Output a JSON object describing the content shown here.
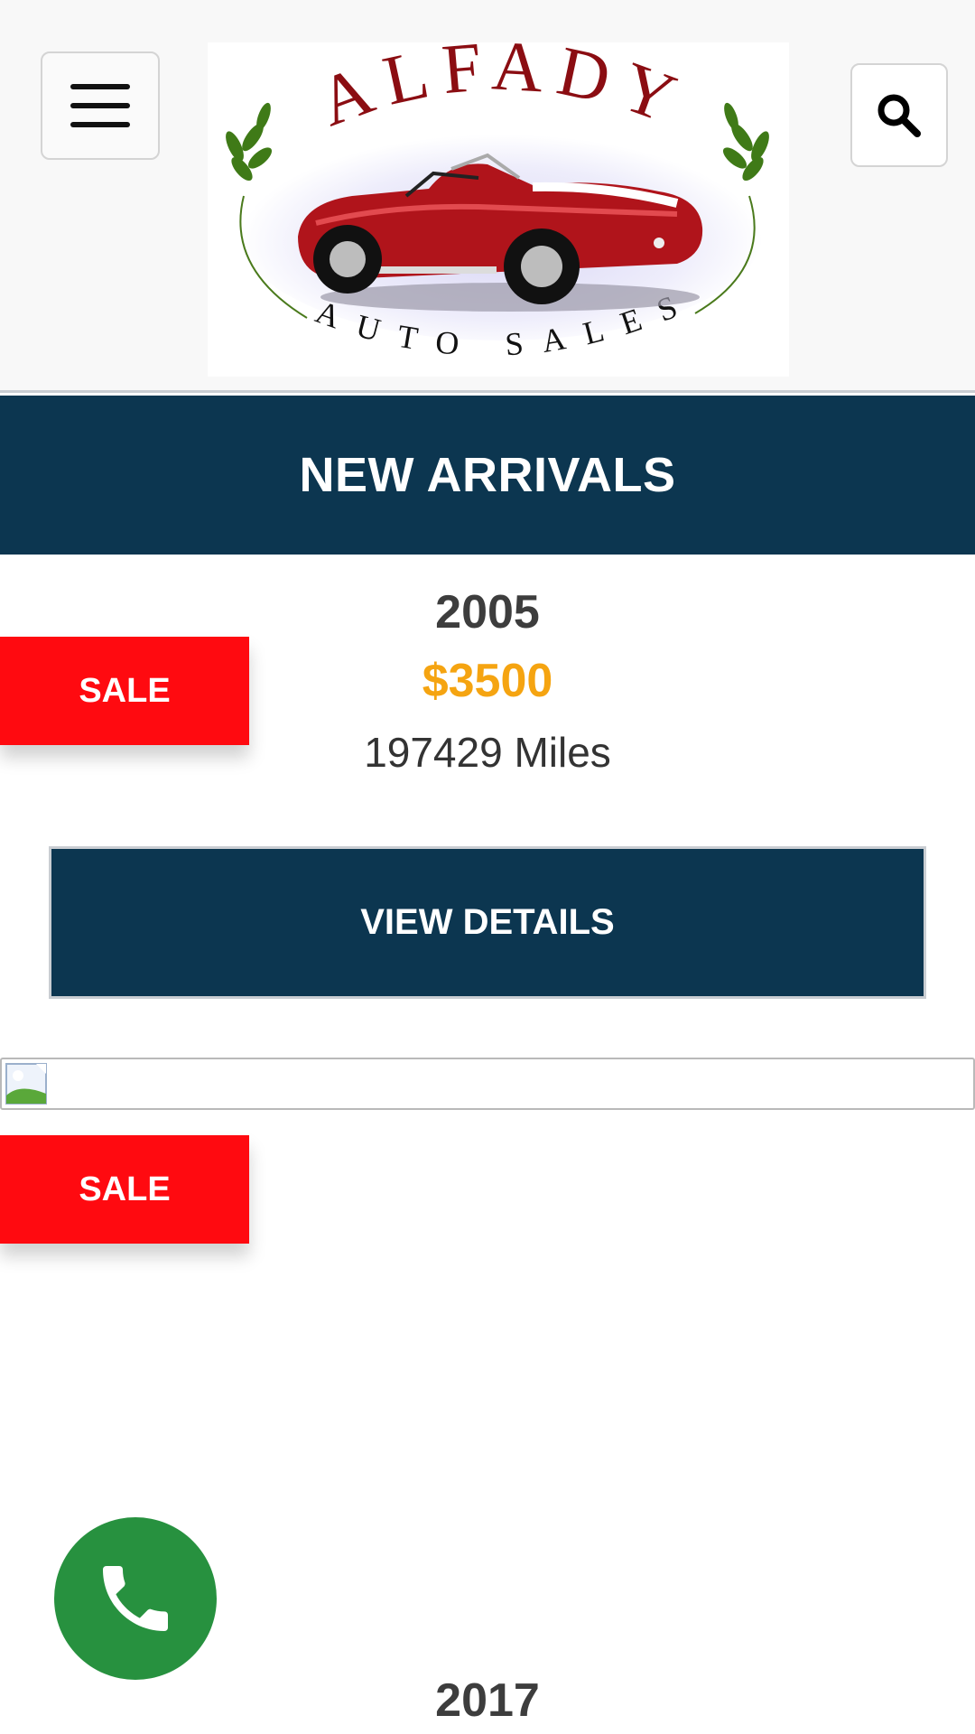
{
  "header": {
    "menu_icon": "hamburger-menu-icon",
    "search_icon": "search-icon",
    "logo": {
      "brand": "ALFADY",
      "tagline": "AUTO SALES"
    }
  },
  "banner": {
    "title": "NEW ARRIVALS"
  },
  "listings": [
    {
      "year": "2005",
      "price": "$3500",
      "miles": "197429 Miles",
      "badge": "SALE",
      "button_label": "VIEW DETAILS"
    },
    {
      "year": "2017",
      "badge": "SALE"
    }
  ],
  "call_button": {
    "icon": "phone-icon"
  },
  "colors": {
    "navy": "#0c3650",
    "sale_red": "#ff0a10",
    "price_orange": "#f5a411",
    "call_green": "#27913f"
  }
}
